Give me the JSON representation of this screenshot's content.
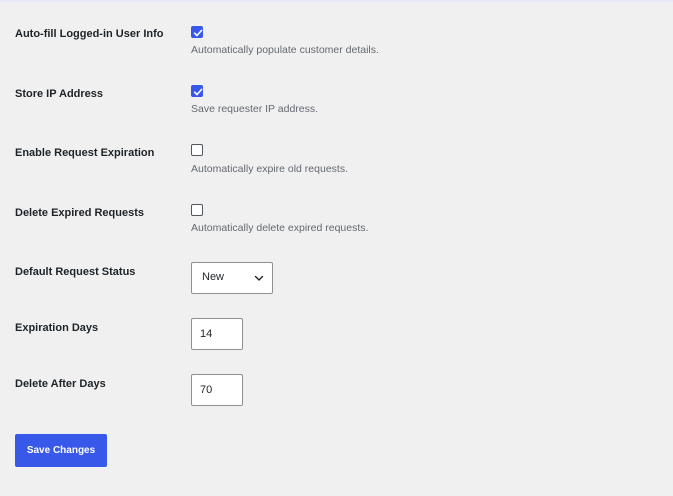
{
  "settings": {
    "autofill": {
      "label": "Auto-fill Logged-in User Info",
      "checked": true,
      "description": "Automatically populate customer details."
    },
    "store_ip": {
      "label": "Store IP Address",
      "checked": true,
      "description": "Save requester IP address."
    },
    "enable_expiration": {
      "label": "Enable Request Expiration",
      "checked": false,
      "description": "Automatically expire old requests."
    },
    "delete_expired": {
      "label": "Delete Expired Requests",
      "checked": false,
      "description": "Automatically delete expired requests."
    },
    "default_status": {
      "label": "Default Request Status",
      "selected": "New"
    },
    "expiration_days": {
      "label": "Expiration Days",
      "value": "14"
    },
    "delete_after_days": {
      "label": "Delete After Days",
      "value": "70"
    }
  },
  "actions": {
    "save_label": "Save Changes"
  },
  "colors": {
    "accent": "#3858e9",
    "background": "#f0f0f1",
    "description_text": "#646970"
  },
  "icons": {
    "checkmark": "checkmark-icon",
    "select_arrow": "chevron-down-icon"
  }
}
